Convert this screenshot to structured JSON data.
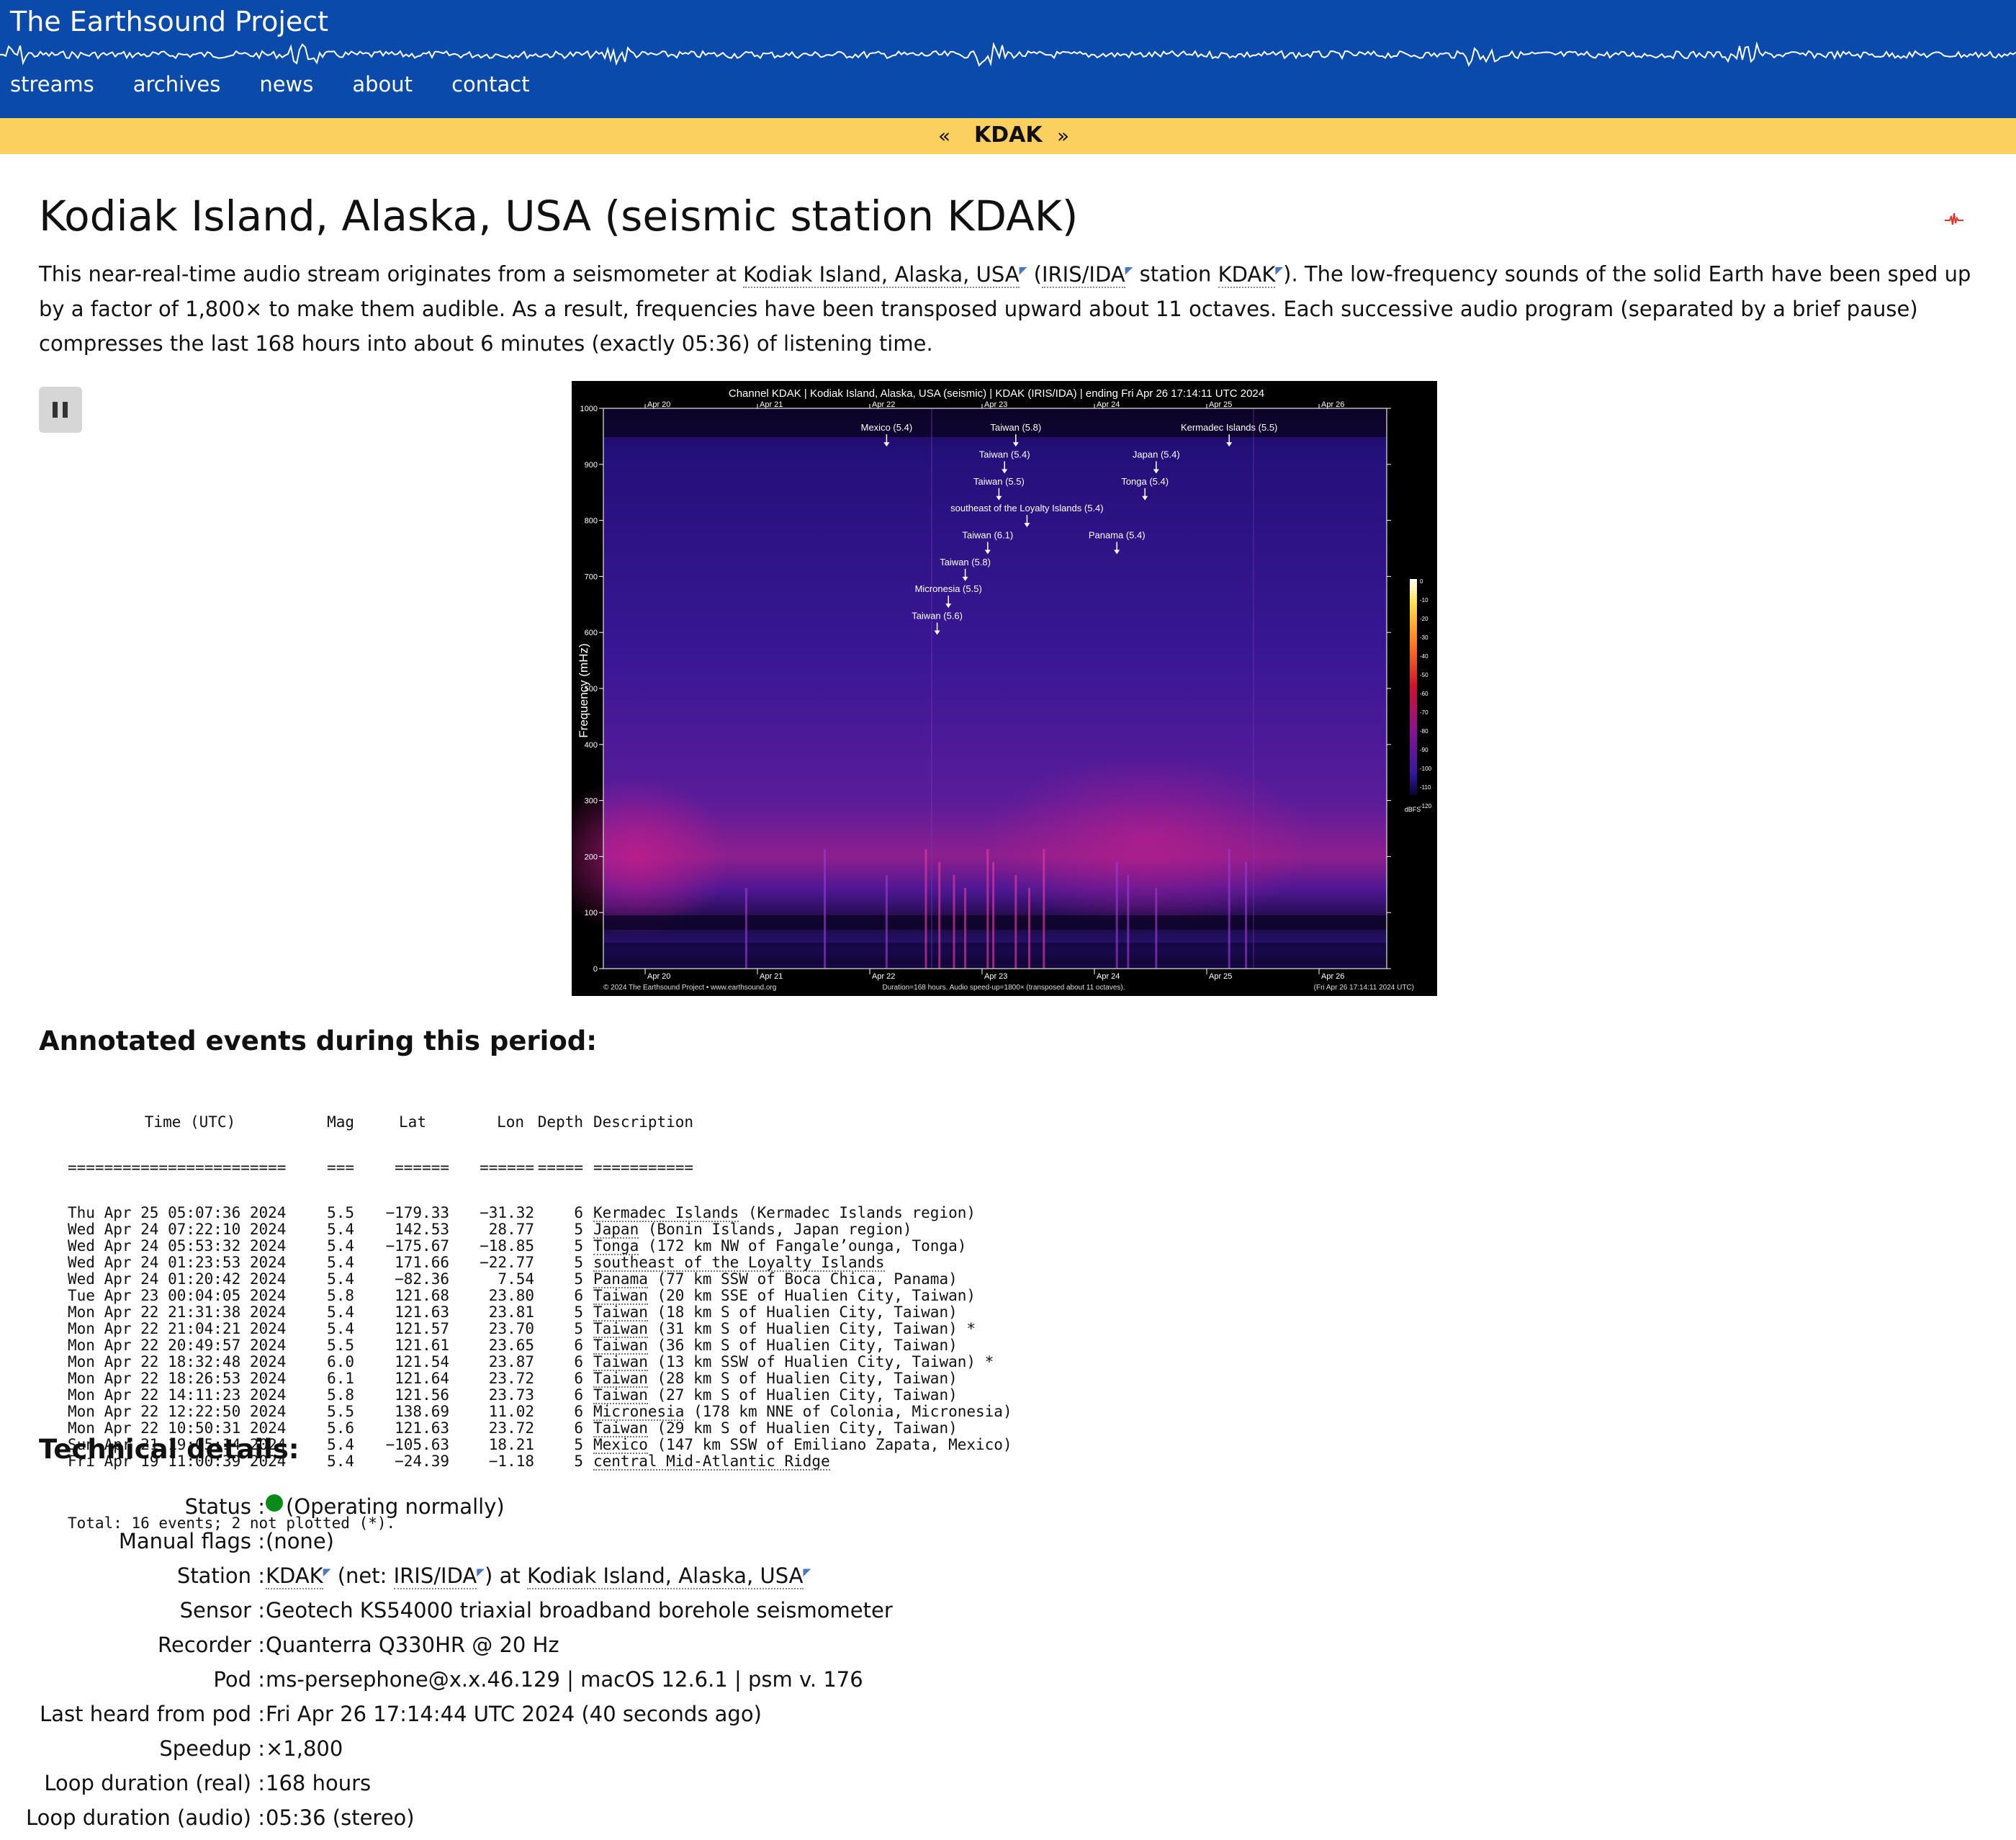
{
  "header": {
    "site_title": "The Earthsound Project",
    "nav": [
      "streams",
      "archives",
      "news",
      "about",
      "contact"
    ],
    "colors": {
      "header_bg": "#0a4aab",
      "station_bar_bg": "#fcd05e"
    }
  },
  "station_bar": {
    "prev": "«",
    "code": "KDAK",
    "next": "»"
  },
  "page": {
    "title": "Kodiak Island, Alaska, USA (seismic station KDAK)",
    "intro": {
      "t1": "This near-real-time audio stream originates from a seismometer at ",
      "location_link": "Kodiak Island, Alaska, USA",
      "t2": " (",
      "network_link": "IRIS/IDA",
      "t3": " station ",
      "station_link": "KDAK",
      "t4": "). The low-frequency sounds of the solid Earth have been sped up by a factor of 1,800× to make them audible. As a result, frequencies have been transposed upward about 11 octaves. Each successive audio program (separated by a brief pause) compresses the last 168 hours into about 6 minutes (exactly 05:36) of listening time."
    }
  },
  "player": {
    "button_icon": "pause-icon"
  },
  "spectrogram": {
    "title": "Channel KDAK | Kodiak Island, Alaska, USA (seismic) | KDAK (IRIS/IDA) | ending Fri Apr 26 17:14:11 UTC 2024",
    "ylabel": "Frequency (mHz)",
    "y_ticks": [
      "0",
      "100",
      "200",
      "300",
      "400",
      "500",
      "600",
      "700",
      "800",
      "900",
      "1000"
    ],
    "x_ticks": [
      "Apr 20",
      "Apr 21",
      "Apr 22",
      "Apr 23",
      "Apr 24",
      "Apr 25",
      "Apr 26"
    ],
    "colorbar_ticks": [
      "0",
      "-10",
      "-20",
      "-30",
      "-40",
      "-50",
      "-60",
      "-70",
      "-80",
      "-90",
      "-100",
      "-110",
      "-120"
    ],
    "colorbar_unit": "dBFS",
    "footer_left": "© 2024 The Earthsound Project • www.earthsound.org",
    "footer_center": "Duration=168 hours. Audio speed-up=1800× (transposed about 11 octaves).",
    "footer_right": "(Fri Apr 26 17:14:11 2024 UTC)",
    "annotations": [
      {
        "label": "Mexico (5.4)",
        "day": 2.15,
        "freq": 960
      },
      {
        "label": "Taiwan (5.8)",
        "day": 3.3,
        "freq": 960
      },
      {
        "label": "Kermadec Islands (5.5)",
        "day": 5.2,
        "freq": 960
      },
      {
        "label": "Taiwan (5.4)",
        "day": 3.2,
        "freq": 912
      },
      {
        "label": "Japan (5.4)",
        "day": 4.55,
        "freq": 912
      },
      {
        "label": "Taiwan (5.5)",
        "day": 3.15,
        "freq": 864
      },
      {
        "label": "Tonga (5.4)",
        "day": 4.45,
        "freq": 864
      },
      {
        "label": "southeast of the Loyalty Islands (5.4)",
        "day": 3.4,
        "freq": 816
      },
      {
        "label": "Taiwan (6.1)",
        "day": 3.05,
        "freq": 768
      },
      {
        "label": "Panama (5.4)",
        "day": 4.2,
        "freq": 768
      },
      {
        "label": "Taiwan (5.8)",
        "day": 2.85,
        "freq": 720
      },
      {
        "label": "Micronesia (5.5)",
        "day": 2.7,
        "freq": 672
      },
      {
        "label": "Taiwan (5.6)",
        "day": 2.6,
        "freq": 624
      }
    ]
  },
  "events": {
    "heading": "Annotated events during this period:",
    "header_line": {
      "time": "Time (UTC)",
      "mag": "Mag",
      "lat": "Lat",
      "lon": "Lon",
      "depth": "Depth",
      "desc": "Description"
    },
    "rule_line": {
      "time": "========================",
      "mag": "===",
      "lat": "======",
      "lon": "======",
      "depth": "=====",
      "desc": "==========="
    },
    "rows": [
      {
        "time": "Thu Apr 25 05:07:36 2024",
        "mag": "5.5",
        "lat": "−179.33",
        "lon": "−31.32",
        "depth": "6",
        "region": "Kermadec Islands",
        "detail": " (Kermadec Islands region)"
      },
      {
        "time": "Wed Apr 24 07:22:10 2024",
        "mag": "5.4",
        "lat": "142.53",
        "lon": "28.77",
        "depth": "5",
        "region": "Japan",
        "detail": " (Bonin Islands, Japan region)"
      },
      {
        "time": "Wed Apr 24 05:53:32 2024",
        "mag": "5.4",
        "lat": "−175.67",
        "lon": "−18.85",
        "depth": "5",
        "region": "Tonga",
        "detail": " (172 km NW of Fangale’ounga, Tonga)"
      },
      {
        "time": "Wed Apr 24 01:23:53 2024",
        "mag": "5.4",
        "lat": "171.66",
        "lon": "−22.77",
        "depth": "5",
        "region": "southeast of the Loyalty Islands",
        "detail": ""
      },
      {
        "time": "Wed Apr 24 01:20:42 2024",
        "mag": "5.4",
        "lat": "−82.36",
        "lon": "7.54",
        "depth": "5",
        "region": "Panama",
        "detail": " (77 km SSW of Boca Chica, Panama)"
      },
      {
        "time": "Tue Apr 23 00:04:05 2024",
        "mag": "5.8",
        "lat": "121.68",
        "lon": "23.80",
        "depth": "6",
        "region": "Taiwan",
        "detail": " (20 km SSE of Hualien City, Taiwan)"
      },
      {
        "time": "Mon Apr 22 21:31:38 2024",
        "mag": "5.4",
        "lat": "121.63",
        "lon": "23.81",
        "depth": "5",
        "region": "Taiwan",
        "detail": " (18 km S of Hualien City, Taiwan)"
      },
      {
        "time": "Mon Apr 22 21:04:21 2024",
        "mag": "5.4",
        "lat": "121.57",
        "lon": "23.70",
        "depth": "5",
        "region": "Taiwan",
        "detail": " (31 km S of Hualien City, Taiwan) *"
      },
      {
        "time": "Mon Apr 22 20:49:57 2024",
        "mag": "5.5",
        "lat": "121.61",
        "lon": "23.65",
        "depth": "6",
        "region": "Taiwan",
        "detail": " (36 km S of Hualien City, Taiwan)"
      },
      {
        "time": "Mon Apr 22 18:32:48 2024",
        "mag": "6.0",
        "lat": "121.54",
        "lon": "23.87",
        "depth": "6",
        "region": "Taiwan",
        "detail": " (13 km SSW of Hualien City, Taiwan) *"
      },
      {
        "time": "Mon Apr 22 18:26:53 2024",
        "mag": "6.1",
        "lat": "121.64",
        "lon": "23.72",
        "depth": "6",
        "region": "Taiwan",
        "detail": " (28 km S of Hualien City, Taiwan)"
      },
      {
        "time": "Mon Apr 22 14:11:23 2024",
        "mag": "5.8",
        "lat": "121.56",
        "lon": "23.73",
        "depth": "6",
        "region": "Taiwan",
        "detail": " (27 km S of Hualien City, Taiwan)"
      },
      {
        "time": "Mon Apr 22 12:22:50 2024",
        "mag": "5.5",
        "lat": "138.69",
        "lon": "11.02",
        "depth": "6",
        "region": "Micronesia",
        "detail": " (178 km NNE of Colonia, Micronesia)"
      },
      {
        "time": "Mon Apr 22 10:50:31 2024",
        "mag": "5.6",
        "lat": "121.63",
        "lon": "23.72",
        "depth": "6",
        "region": "Taiwan",
        "detail": " (29 km S of Hualien City, Taiwan)"
      },
      {
        "time": "Sun Apr 21 19:05:14 2024",
        "mag": "5.4",
        "lat": "−105.63",
        "lon": "18.21",
        "depth": "5",
        "region": "Mexico",
        "detail": " (147 km SSW of Emiliano Zapata, Mexico)"
      },
      {
        "time": "Fri Apr 19 11:00:39 2024",
        "mag": "5.4",
        "lat": "−24.39",
        "lon": "−1.18",
        "depth": "5",
        "region": "central Mid-Atlantic Ridge",
        "detail": ""
      }
    ],
    "total": "Total: 16 events; 2 not plotted (*)."
  },
  "tech": {
    "heading": "Technical details:",
    "status_color": "#0a8a17",
    "rows": [
      {
        "label": "Status :",
        "value": "(Operating normally)"
      },
      {
        "label": "Manual flags :",
        "value": "(none)"
      },
      {
        "label": "Station :",
        "station": "KDAK",
        "t1": " (net: ",
        "net": "IRIS/IDA",
        "t2": ") at ",
        "place": "Kodiak Island, Alaska, USA"
      },
      {
        "label": "Sensor :",
        "value": "Geotech KS54000 triaxial broadband borehole seismometer"
      },
      {
        "label": "Recorder :",
        "value": "Quanterra Q330HR @ 20 Hz"
      },
      {
        "label": "Pod :",
        "value": "ms-persephone@x.x.46.129 | macOS 12.6.1 | psm v. 176"
      },
      {
        "label": "Last heard from pod :",
        "value": "Fri Apr 26 17:14:44 UTC 2024 (40 seconds ago)"
      },
      {
        "label": "Speedup :",
        "value": "×1,800"
      },
      {
        "label": "Loop duration (real) :",
        "value": "168 hours"
      },
      {
        "label": "Loop duration (audio) :",
        "value": "05:36 (stereo)"
      }
    ]
  }
}
